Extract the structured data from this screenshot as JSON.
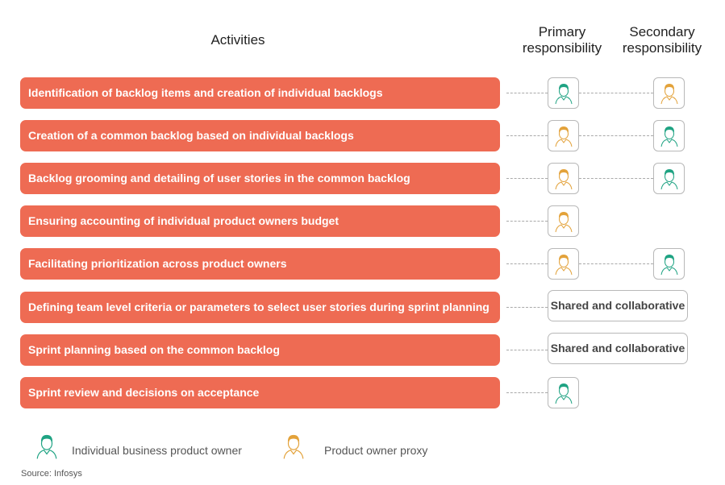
{
  "headers": {
    "activities": "Activities",
    "primary": "Primary responsibility",
    "secondary": "Secondary responsibility"
  },
  "colors": {
    "activity_bar": "#ee6b53",
    "individual_business_product_owner": "#1fa383",
    "product_owner_proxy": "#e3a23a"
  },
  "activities": [
    {
      "label": "Identification of backlog items and creation of individual backlogs",
      "primary": "individual-business-product-owner",
      "secondary": "product-owner-proxy"
    },
    {
      "label": "Creation of a common backlog based on individual backlogs",
      "primary": "product-owner-proxy",
      "secondary": "individual-business-product-owner"
    },
    {
      "label": "Backlog grooming and detailing of user stories in the common backlog",
      "primary": "product-owner-proxy",
      "secondary": "individual-business-product-owner"
    },
    {
      "label": "Ensuring accounting of individual product owners budget",
      "primary": "product-owner-proxy",
      "secondary": null
    },
    {
      "label": "Facilitating prioritization across product owners",
      "primary": "product-owner-proxy",
      "secondary": "individual-business-product-owner"
    },
    {
      "label": "Defining team level criteria or parameters to select user stories during  sprint planning",
      "shared": "Shared and collaborative"
    },
    {
      "label": "Sprint planning based on the common backlog",
      "shared": "Shared and collaborative"
    },
    {
      "label": "Sprint review and decisions on acceptance",
      "primary": "individual-business-product-owner",
      "secondary": null
    }
  ],
  "legend": [
    {
      "role": "individual-business-product-owner",
      "label": "Individual business product owner"
    },
    {
      "role": "product-owner-proxy",
      "label": "Product owner proxy"
    }
  ],
  "source": "Source: Infosys"
}
